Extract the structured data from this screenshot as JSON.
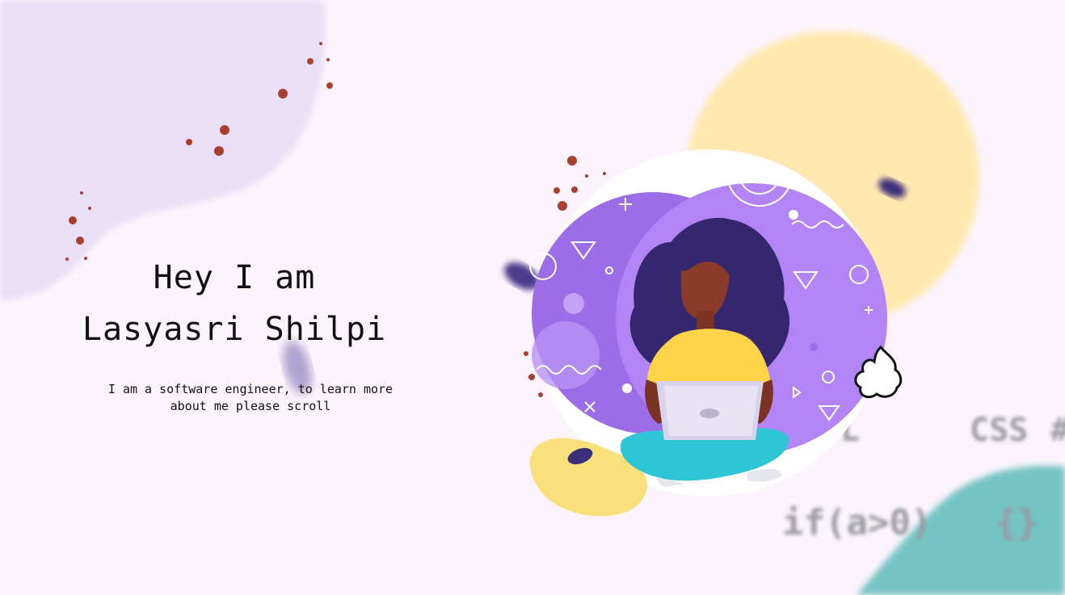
{
  "hero": {
    "greeting": "Hey I am",
    "name": "Lasyasri Shilpi",
    "subtitle_line1": "I am a software engineer, to learn more",
    "subtitle_line2": "about me please scroll"
  },
  "background_code": {
    "css": "CSS",
    "hash": "#",
    "l": "L",
    "condition": "if(a>0)",
    "braces": "{}"
  },
  "colors": {
    "page_bg": "#fcf4fc",
    "lavender_blob": "#e9dff7",
    "yellow_circle": "#ffe9b0",
    "teal_blob": "#74c4c4",
    "purple_circle": "#a87ef0",
    "dot_red": "#a8402f"
  },
  "illustration": {
    "description_icon": "woman-with-laptop-illustration"
  }
}
